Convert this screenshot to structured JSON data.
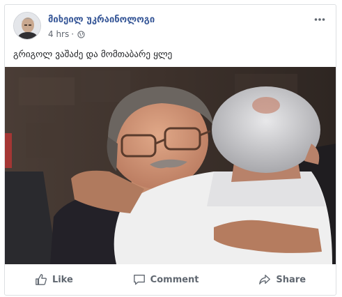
{
  "post": {
    "author": "მიხეილ უკრაინოლოგი",
    "time": "4 hrs",
    "separator": "·",
    "privacy_icon": "globe-icon",
    "more_icon": "more-dots-icon",
    "caption": "გრიგოლ ვაშაძე და მომთაბარე ყლე"
  },
  "actions": {
    "like": {
      "label": "Like",
      "icon": "thumbs-up-icon"
    },
    "comment": {
      "label": "Comment",
      "icon": "comment-icon"
    },
    "share": {
      "label": "Share",
      "icon": "share-icon"
    }
  },
  "colors": {
    "link": "#385898",
    "secondary_text": "#616770",
    "action_text": "#606770",
    "border": "#dddfe2"
  }
}
